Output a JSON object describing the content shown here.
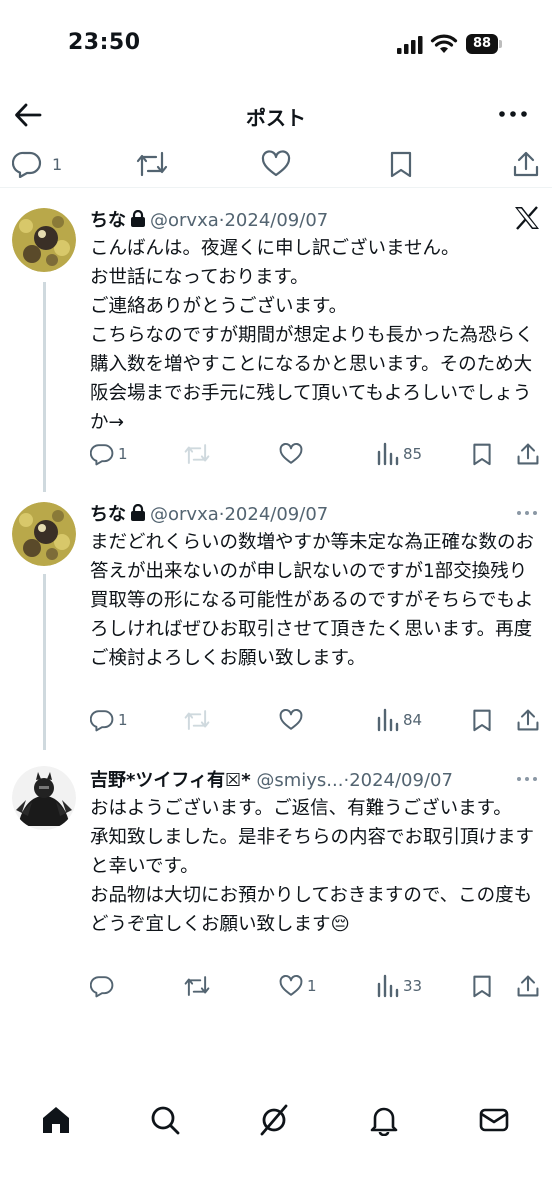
{
  "status_bar": {
    "time": "23:50",
    "battery": "88"
  },
  "header": {
    "title": "ポスト"
  },
  "top_actions": {
    "reply_count": "1"
  },
  "tweets": [
    {
      "name": "ちな",
      "handle": "@orvxa",
      "separator": "·",
      "date": "2024/09/07",
      "text": "こんばんは。夜遅くに申し訳ございません。\nお世話になっております。\nご連絡ありがとうございます。\nこちらなのですが期間が想定よりも長かった為恐らく購入数を増やすことになるかと思います。そのため大阪会場までお手元に残して頂いてもよろしいでしょうか→",
      "reply_count": "1",
      "retweet_count": "",
      "like_count": "",
      "view_count": "85"
    },
    {
      "name": "ちな",
      "handle": "@orvxa",
      "separator": "·",
      "date": "2024/09/07",
      "text": "まだどれくらいの数増やすか等未定な為正確な数のお答えが出来ないのが申し訳ないのですが1部交換残り買取等の形になる可能性があるのですがそちらでもよろしければぜひお取引させて頂きたく思います。再度ご検討よろしくお願い致します。",
      "reply_count": "1",
      "retweet_count": "",
      "like_count": "",
      "view_count": "84"
    },
    {
      "name": "吉野*ツイフィ有☒*",
      "handle": "@smiys...",
      "separator": "·",
      "date": "2024/09/07",
      "text": "おはようございます。ご返信、有難うございます。\n承知致しました。是非そちらの内容でお取引頂けますと幸いです。\nお品物は大切にお預かりしておきますので、この度もどうぞ宜しくお願い致します",
      "emoji": "😔",
      "reply_count": "",
      "retweet_count": "",
      "like_count": "1",
      "view_count": "33"
    }
  ],
  "colors": {
    "text": "#0f1419",
    "secondary": "#536471",
    "thread_line": "#cfd9de",
    "retweet_disabled": "#cfd9de"
  },
  "icons": [
    "back-arrow-icon",
    "more-icon",
    "reply-icon",
    "retweet-icon",
    "like-icon",
    "bookmark-icon",
    "share-icon",
    "views-icon",
    "x-logo-icon",
    "lock-icon",
    "home-icon",
    "search-icon",
    "grok-icon",
    "notifications-icon",
    "messages-icon"
  ]
}
